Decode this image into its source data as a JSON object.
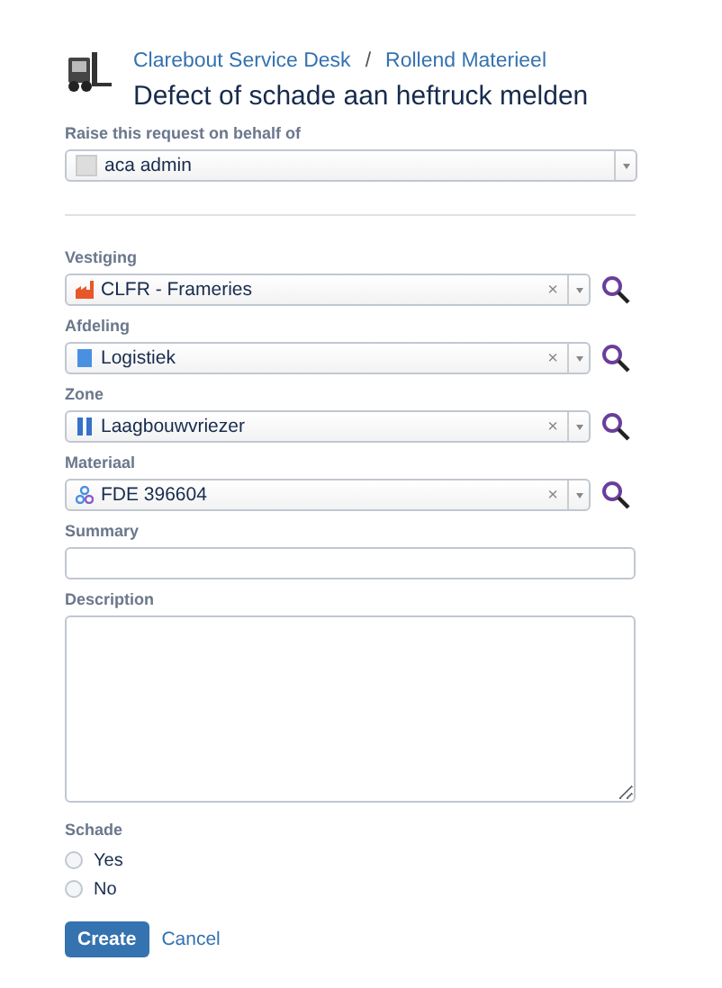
{
  "breadcrumbs": [
    "Clarebout Service Desk",
    "Rollend Materieel"
  ],
  "breadcrumb_separator": "/",
  "title": "Defect of schade aan heftruck melden",
  "behalf": {
    "label": "Raise this request on behalf of",
    "value": "aca admin"
  },
  "pickers": [
    {
      "label": "Vestiging",
      "value": "CLFR - Frameries",
      "kind": "factory"
    },
    {
      "label": "Afdeling",
      "value": "Logistiek",
      "kind": "building"
    },
    {
      "label": "Zone",
      "value": "Laagbouwvriezer",
      "kind": "zone"
    },
    {
      "label": "Materiaal",
      "value": "FDE 396604",
      "kind": "asset"
    }
  ],
  "clear_glyph": "×",
  "summary": {
    "label": "Summary"
  },
  "description": {
    "label": "Description"
  },
  "schade": {
    "label": "Schade",
    "options": [
      {
        "label": "Yes",
        "selected": false
      },
      {
        "label": "No",
        "selected": false
      }
    ]
  },
  "buttons": {
    "create": "Create",
    "cancel": "Cancel"
  }
}
